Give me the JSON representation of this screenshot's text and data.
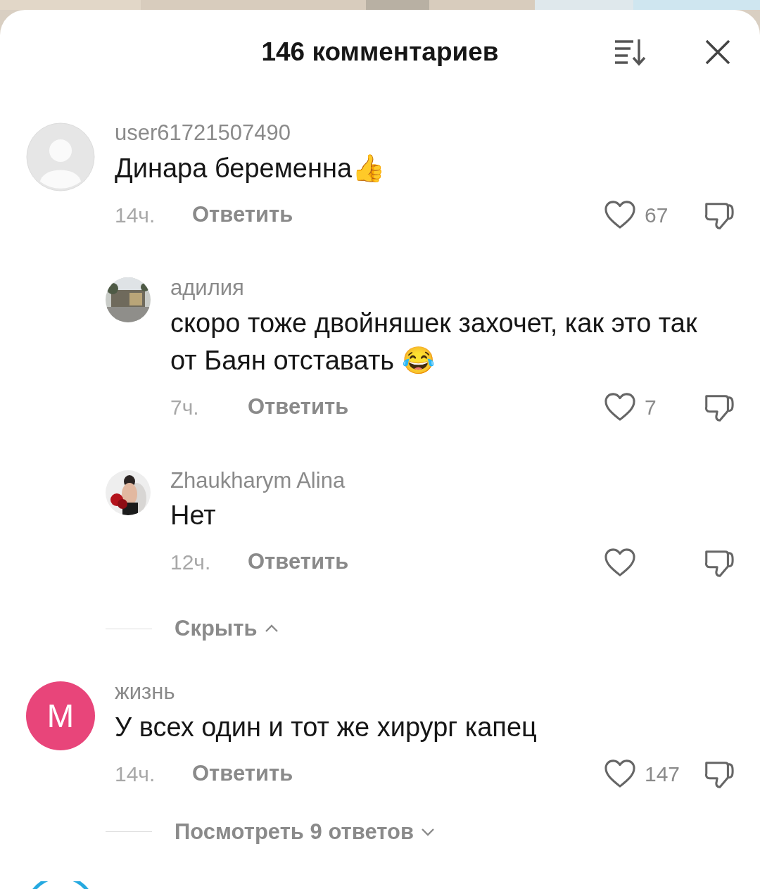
{
  "header": {
    "title": "146 комментариев"
  },
  "comments": [
    {
      "avatar": {
        "kind": "default"
      },
      "username": "user61721507490",
      "text": "Динара беременна👍",
      "time": "14ч.",
      "reply_label": "Ответить",
      "likes": "67",
      "replies": [
        {
          "username": "адилия",
          "text": "скоро тоже двойняшек захочет, как это так от Баян отставать 😂",
          "time": "7ч.",
          "reply_label": "Ответить",
          "likes": "7"
        },
        {
          "username": "Zhaukharym Alina",
          "text": "Нет",
          "time": "12ч.",
          "reply_label": "Ответить"
        }
      ],
      "replies_toggle": {
        "label": "Скрыть",
        "expanded": true
      }
    },
    {
      "avatar": {
        "kind": "letter",
        "letter": "M",
        "color": "#e8457a"
      },
      "username": "жизнь",
      "text": "У всех один и тот же хирург капец",
      "time": "14ч.",
      "reply_label": "Ответить",
      "likes": "147",
      "replies_toggle": {
        "label": "Посмотреть 9 ответов",
        "expanded": false
      }
    }
  ]
}
